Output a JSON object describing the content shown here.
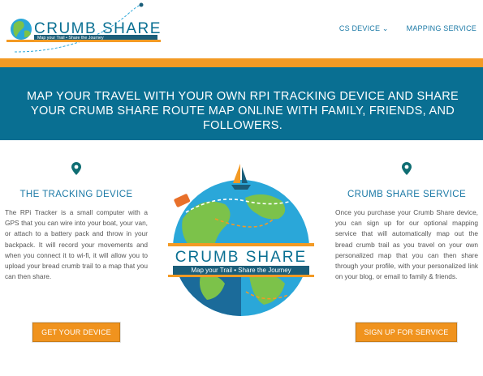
{
  "brand": {
    "name": "CRUMB SHARE",
    "tagline": "Map your Trail • Share the Journey"
  },
  "nav": {
    "items": [
      {
        "label": "CS DEVICE ⌄"
      },
      {
        "label": "MAPPING SERVICE"
      }
    ]
  },
  "hero": {
    "text": "MAP YOUR TRAVEL WITH YOUR OWN RPI TRACKING DEVICE AND SHARE YOUR CRUMB SHARE ROUTE MAP ONLINE WITH FAMILY, FRIENDS, AND FOLLOWERS."
  },
  "tracking": {
    "title": "THE TRACKING DEVICE",
    "body": "The RPi Tracker is a small computer with a GPS that you can wire into your boat, your van, or attach to a battery pack and throw in your backpack. It will record your movements and when you connect it to wi-fi, it will allow you to upload your bread crumb trail to a map that you can then share.",
    "button": "GET YOUR DEVICE"
  },
  "service": {
    "title": "CRUMB SHARE SERVICE",
    "body": "Once you purchase your Crumb Share device, you can sign up for our optional mapping service that will automatically map out the bread crumb trail as you travel on your own personalized map that you can then share through your profile, with your personalized link on your blog, or email to family & friends.",
    "button": "SIGN UP FOR SERVICE"
  },
  "colors": {
    "primary": "#096f92",
    "accent": "#f39a24",
    "link": "#1b79a6"
  }
}
